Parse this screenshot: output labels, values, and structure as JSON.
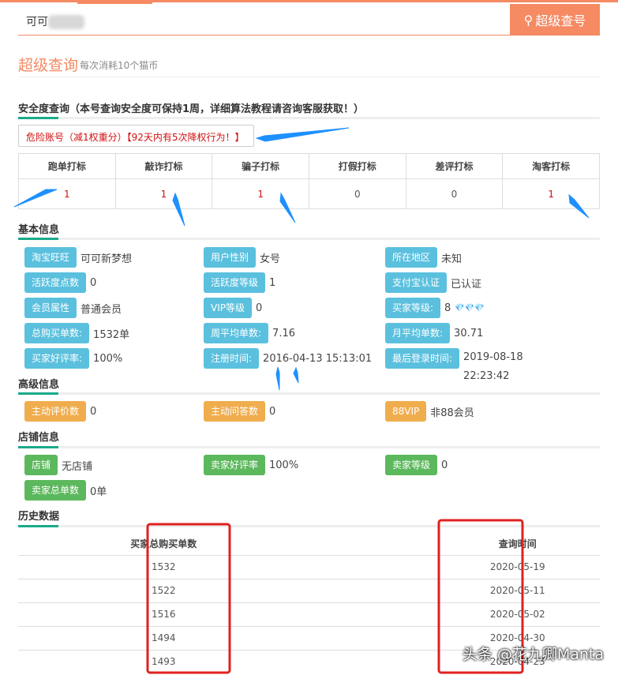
{
  "search": {
    "value_prefix": "可可",
    "button": "超级查号",
    "icon": "search-icon"
  },
  "header": {
    "title": "超级查询",
    "subtitle": "每次消耗10个猫币"
  },
  "security": {
    "heading": "安全度查询（本号查询安全度可保持1周，详细算法教程请咨询客服获取！）",
    "alert": "危险账号（减1权重分）【92天内有5次降权行为！】",
    "columns": [
      "跑单打标",
      "敲诈打标",
      "骗子打标",
      "打假打标",
      "差评打标",
      "淘客打标"
    ],
    "values": [
      "1",
      "1",
      "1",
      "0",
      "0",
      "1"
    ]
  },
  "basic": {
    "heading": "基本信息",
    "items": [
      {
        "label": "淘宝旺旺",
        "value": "可可新梦想"
      },
      {
        "label": "用户性别",
        "value": "女号"
      },
      {
        "label": "所在地区",
        "value": "未知"
      },
      {
        "label": "活跃度点数",
        "value": "0"
      },
      {
        "label": "活跃度等级",
        "value": "1"
      },
      {
        "label": "支付宝认证",
        "value": "已认证"
      },
      {
        "label": "会员属性",
        "value": "普通会员"
      },
      {
        "label": "VIP等级",
        "value": "0"
      },
      {
        "label": "买家等级:",
        "value": "8"
      },
      {
        "label": "总购买单数:",
        "value": "1532单"
      },
      {
        "label": "周平均单数:",
        "value": "7.16"
      },
      {
        "label": "月平均单数:",
        "value": "30.71"
      },
      {
        "label": "买家好评率:",
        "value": "100%"
      },
      {
        "label": "注册时间:",
        "value": "2016-04-13 15:13:01"
      },
      {
        "label": "最后登录时间:",
        "value": "2019-08-18 22:23:42"
      }
    ]
  },
  "advanced": {
    "heading": "高级信息",
    "items": [
      {
        "label": "主动评价数",
        "value": "0"
      },
      {
        "label": "主动问答数",
        "value": "0"
      },
      {
        "label": "88VIP",
        "value": "非88会员"
      }
    ]
  },
  "shop": {
    "heading": "店铺信息",
    "items": [
      {
        "label": "店铺",
        "value": "无店铺"
      },
      {
        "label": "卖家好评率",
        "value": "100%"
      },
      {
        "label": "卖家等级",
        "value": "0"
      },
      {
        "label": "卖家总单数",
        "value": "0单"
      }
    ]
  },
  "history": {
    "heading": "历史数据",
    "columns": [
      "买家总购买单数",
      "查询时间"
    ],
    "rows": [
      [
        "1532",
        "2020-05-19"
      ],
      [
        "1522",
        "2020-05-11"
      ],
      [
        "1516",
        "2020-05-02"
      ],
      [
        "1494",
        "2020-04-30"
      ],
      [
        "1493",
        "2020-04-23"
      ]
    ]
  },
  "watermark": "头条 @花九卿Manta",
  "colors": {
    "accent": "#f58a63",
    "teal": "#1aaa8a",
    "info": "#5bc0de",
    "warning": "#f0ad4e",
    "success": "#5cb85c",
    "danger": "#d01010"
  }
}
